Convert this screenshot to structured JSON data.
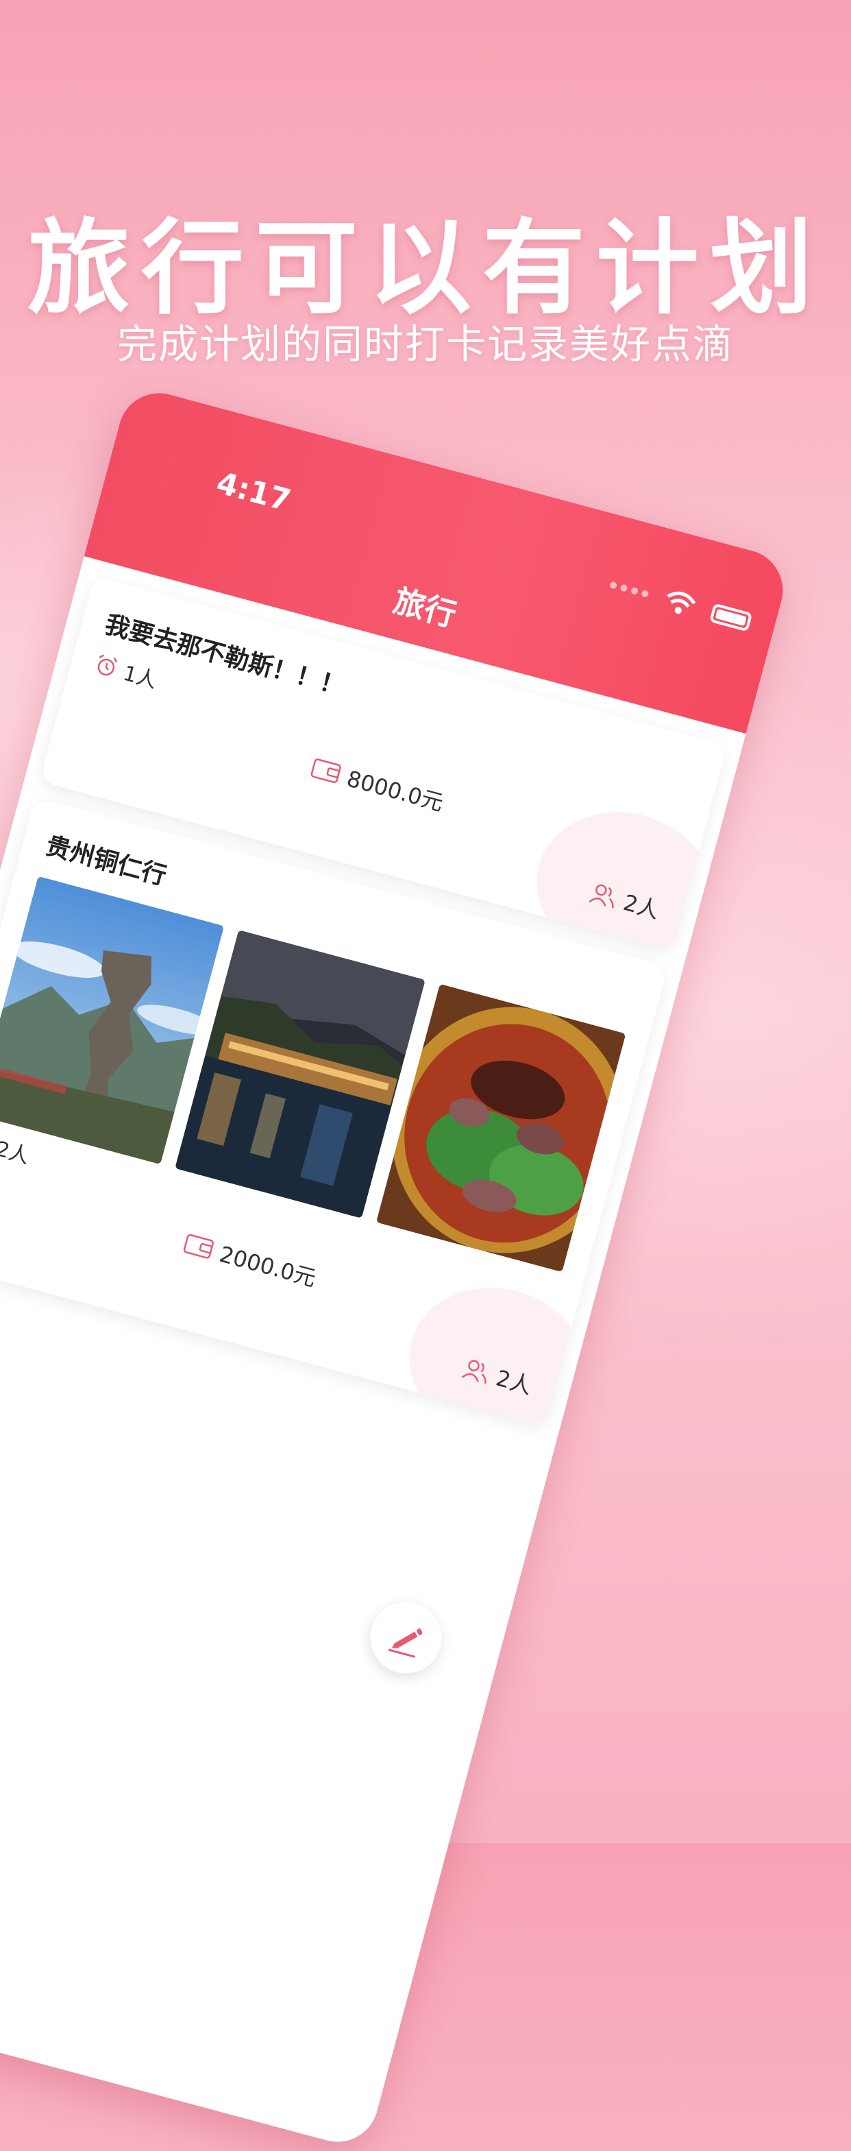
{
  "promo": {
    "headline": "旅行可以有计划",
    "subline": "完成计划的同时打卡记录美好点滴"
  },
  "status_bar": {
    "time": "4:17"
  },
  "nav": {
    "title": "旅行"
  },
  "trips": [
    {
      "name": "我要去那不勒斯！！！",
      "people_count": "1人",
      "budget": "8000.0元",
      "members": "2人",
      "photos": []
    },
    {
      "name": "贵州铜仁行",
      "people_count": "2人",
      "budget": "2000.0元",
      "members": "2人",
      "photos": [
        "mountain-rock-photo",
        "river-night-town-photo",
        "beef-noodle-photo"
      ]
    }
  ],
  "colors": {
    "accent": "#f24d63",
    "icon_pink": "#e85a72",
    "background_pink": "#fbc3cf"
  },
  "icons": {
    "people": "alarm-clock-icon",
    "budget": "wallet-icon",
    "members": "people-icon",
    "fab": "pencil-icon"
  }
}
